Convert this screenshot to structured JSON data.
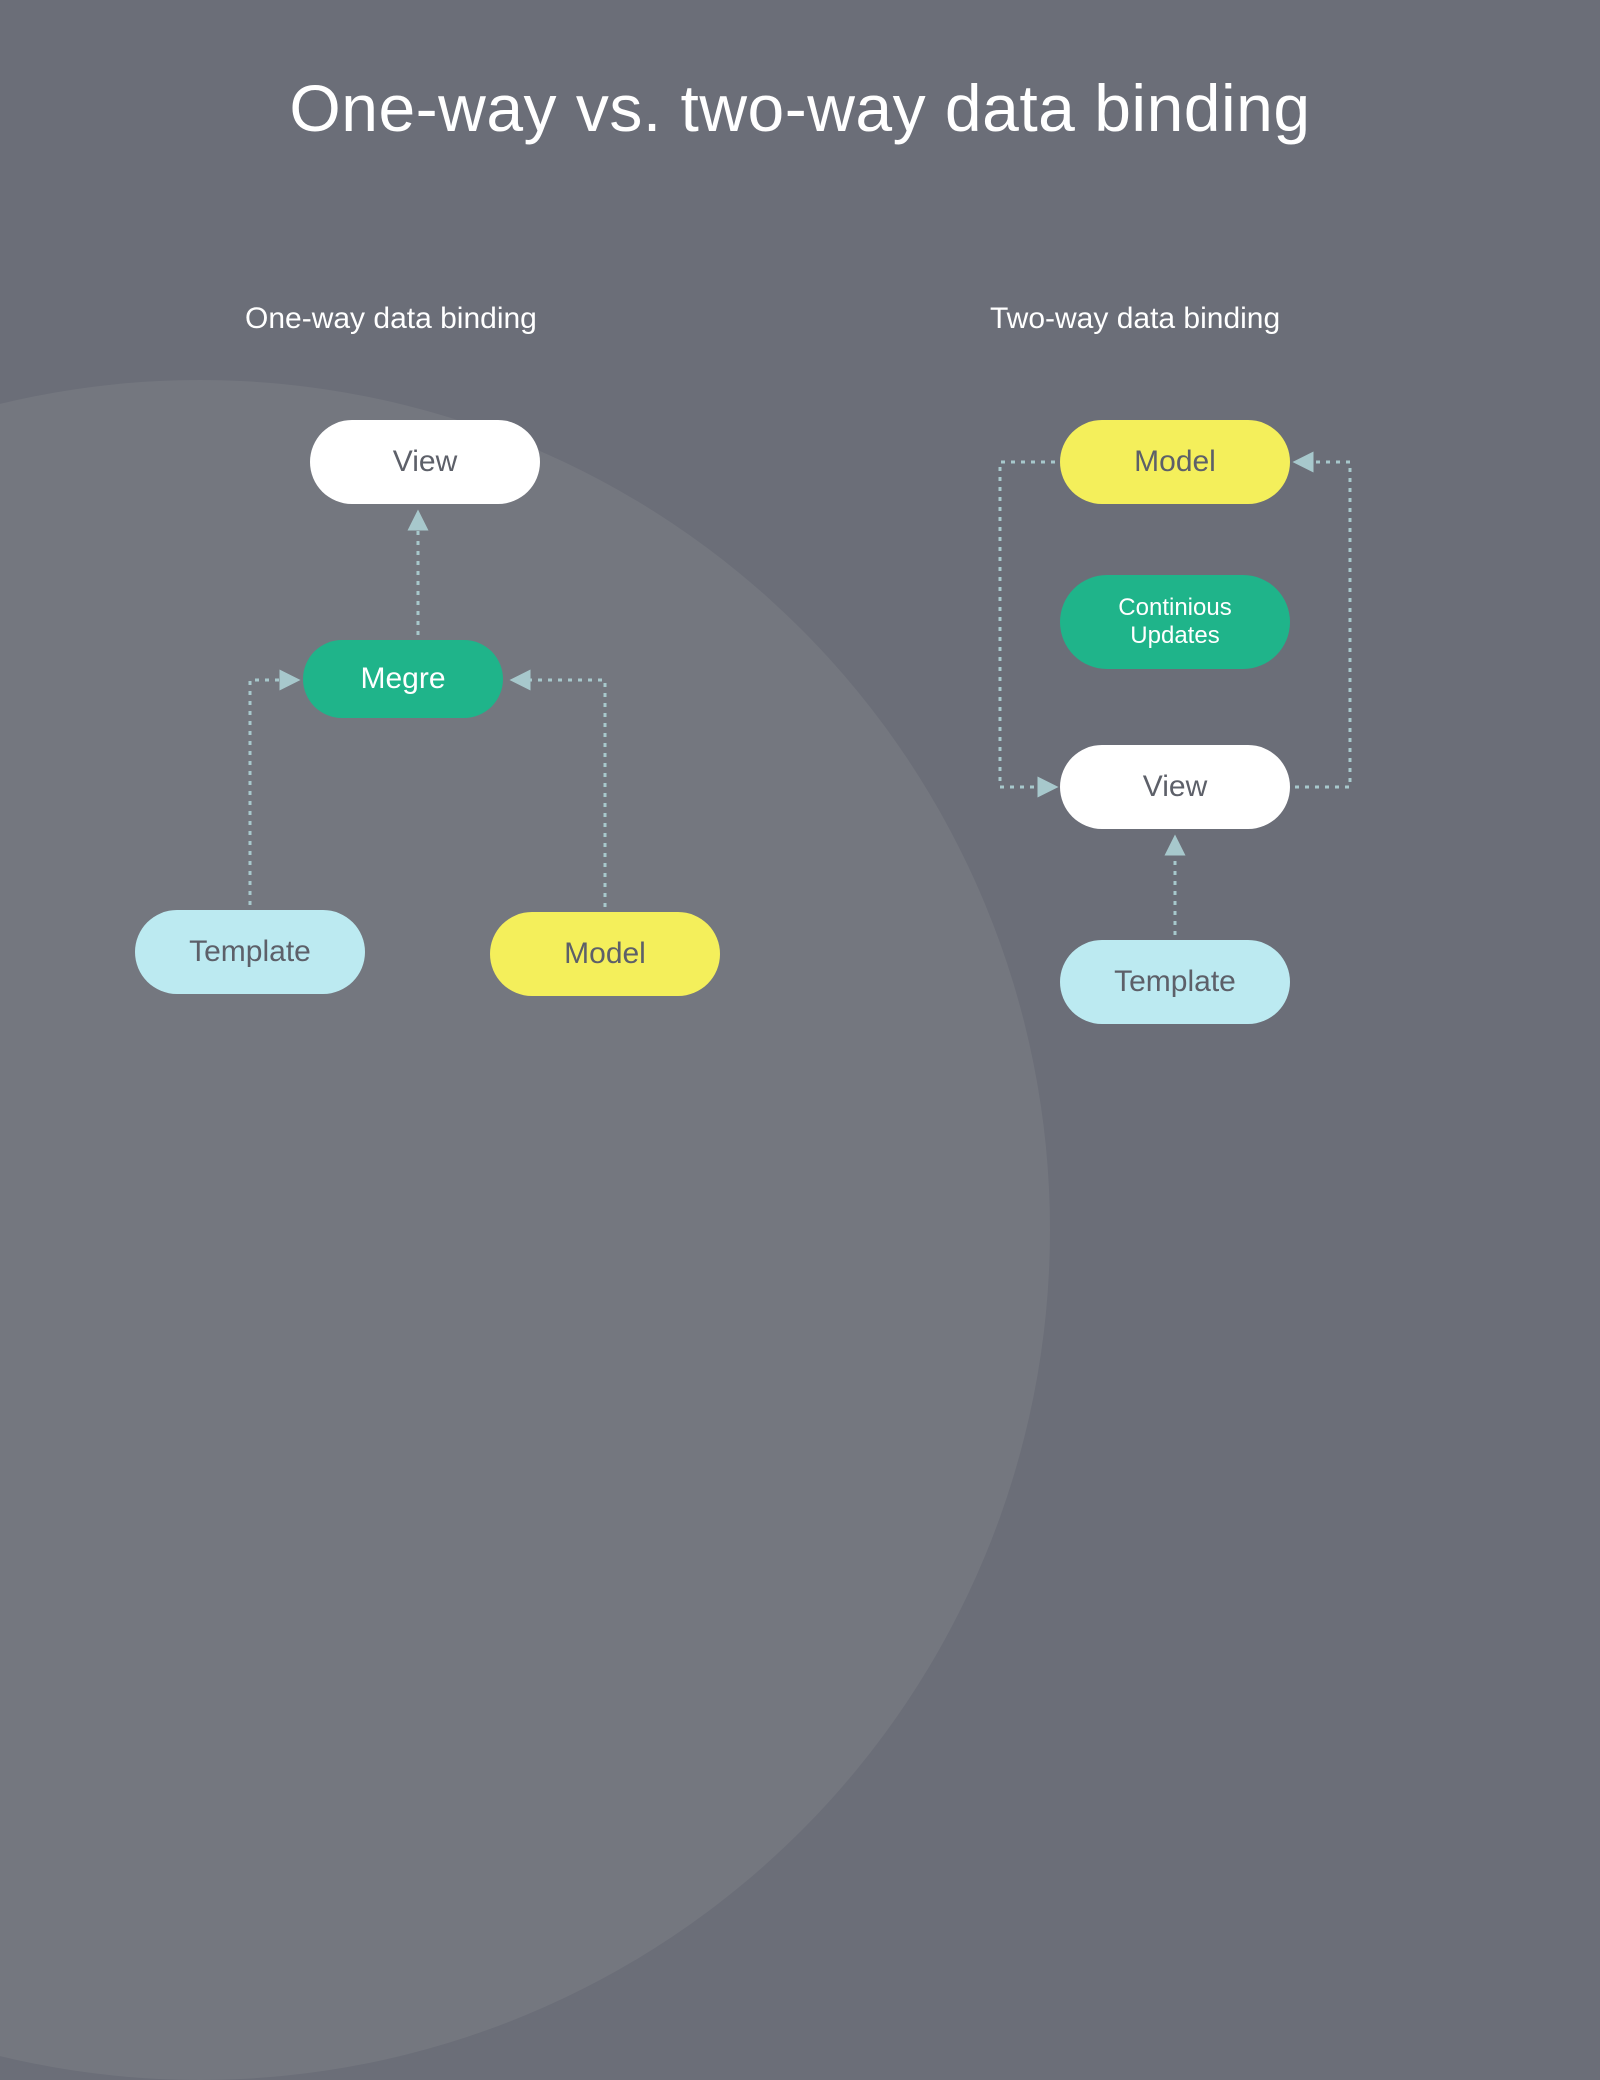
{
  "title": "One-way vs. two-way data binding",
  "left": {
    "subtitle": "One-way data binding",
    "view": "View",
    "merge": "Megre",
    "template": "Template",
    "model": "Model"
  },
  "right": {
    "subtitle": "Two-way data binding",
    "model": "Model",
    "updates": "Continious Updates",
    "view": "View",
    "template": "Template"
  },
  "colors": {
    "bg": "#6b6e78",
    "circle": "#74777f",
    "white": "#ffffff",
    "green": "#1fb48a",
    "lightblue": "#bceaf1",
    "yellow": "#f4ef5b",
    "arrow": "#a7c8cc"
  }
}
